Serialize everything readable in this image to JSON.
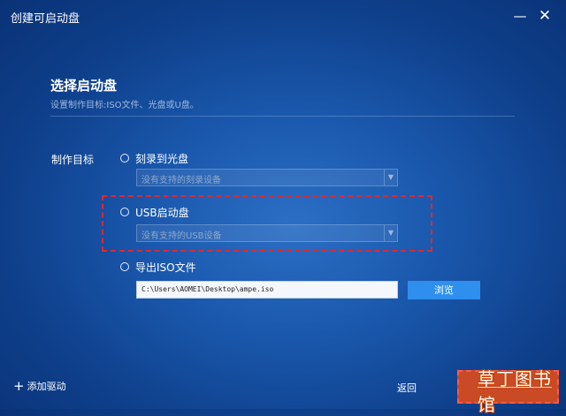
{
  "window": {
    "title": "创建可启动盘",
    "minimize": "—",
    "close": "✕"
  },
  "section": {
    "title": "选择启动盘",
    "subtitle": "设置制作目标:ISO文件、光盘或U盘。"
  },
  "target": {
    "label": "制作目标",
    "options": [
      {
        "label": "刻录到光盘",
        "select_value": "没有支持的刻录设备"
      },
      {
        "label": "USB启动盘",
        "select_value": "没有支持的USB设备"
      },
      {
        "label": "导出ISO文件",
        "path_value": "C:\\Users\\AOMEI\\Desktop\\ampe.iso"
      }
    ],
    "browse_label": "浏览"
  },
  "footer": {
    "add_driver_label": "添加驱动",
    "back_label": "返回"
  },
  "watermark": {
    "text": "草丁图书馆"
  },
  "colors": {
    "accent": "#2f8fef",
    "highlight_border": "#e0282f",
    "next_button": "#c94a25"
  },
  "icons": {
    "add": "plus-icon",
    "dropdown": "chevron-down-icon"
  }
}
